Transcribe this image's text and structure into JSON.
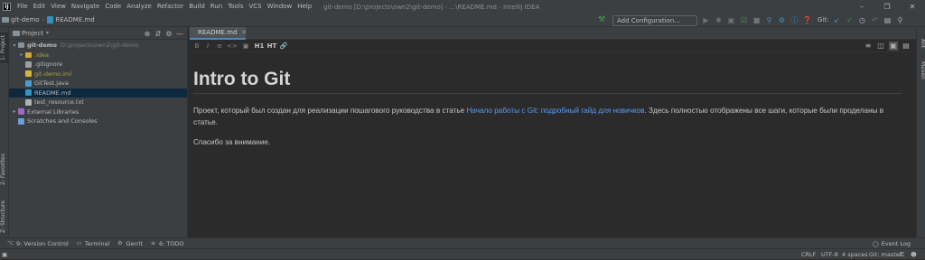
{
  "menu": {
    "items": [
      "File",
      "Edit",
      "View",
      "Navigate",
      "Code",
      "Analyze",
      "Refactor",
      "Build",
      "Run",
      "Tools",
      "VCS",
      "Window",
      "Help"
    ],
    "window_title": "git-demo [D:\\projects\\own2\\git-demo] - ...\\README.md - IntelliJ IDEA"
  },
  "nav": {
    "project": "git-demo",
    "file": "README.md",
    "run_config": "Add Configuration...",
    "git_label": "Git:"
  },
  "left_tabs": {
    "project": "1: Project",
    "favorites": "2: Favorites",
    "structure": "Z: Structure"
  },
  "right_tabs": {
    "ant": "Ant",
    "maven": "Maven"
  },
  "project_panel": {
    "title": "Project",
    "root": {
      "name": "git-demo",
      "path": "D:\\projects\\own2\\git-demo"
    },
    "items": [
      {
        "label": ".idea"
      },
      {
        "label": ".gitignore"
      },
      {
        "label": "git-demo.iml"
      },
      {
        "label": "GitTest.java"
      },
      {
        "label": "README.md"
      },
      {
        "label": "test_resource.txt"
      },
      {
        "label": "External Libraries"
      },
      {
        "label": "Scratches and Consoles"
      }
    ]
  },
  "editor": {
    "tab_label": "README.md",
    "toolbar": {
      "h1": "H1",
      "h2": "HT"
    },
    "heading": "Intro to Git",
    "para_before": "Проект, который был создан для реализации пошагового руководства в статье ",
    "link_text": "Начало работы с Git: подробный гайд для новичков",
    "para_after": ". Здесь полностью отображены все шаги, которые были проделаны в статье.",
    "thanks": "Спасибо за внимание."
  },
  "bottom_tabs": {
    "version_control": "9: Version Control",
    "terminal": "Terminal",
    "gerrit": "Gerrit",
    "todo": "6: TODO",
    "event_log": "Event Log"
  },
  "status": {
    "line_sep": "CRLF",
    "encoding": "UTF-8",
    "indent": "4 spaces",
    "branch": "Git: master"
  },
  "colors": {
    "accent": "#4a88c7",
    "link": "#589df6",
    "ignored": "#a9a045",
    "selection": "#0d293e"
  }
}
